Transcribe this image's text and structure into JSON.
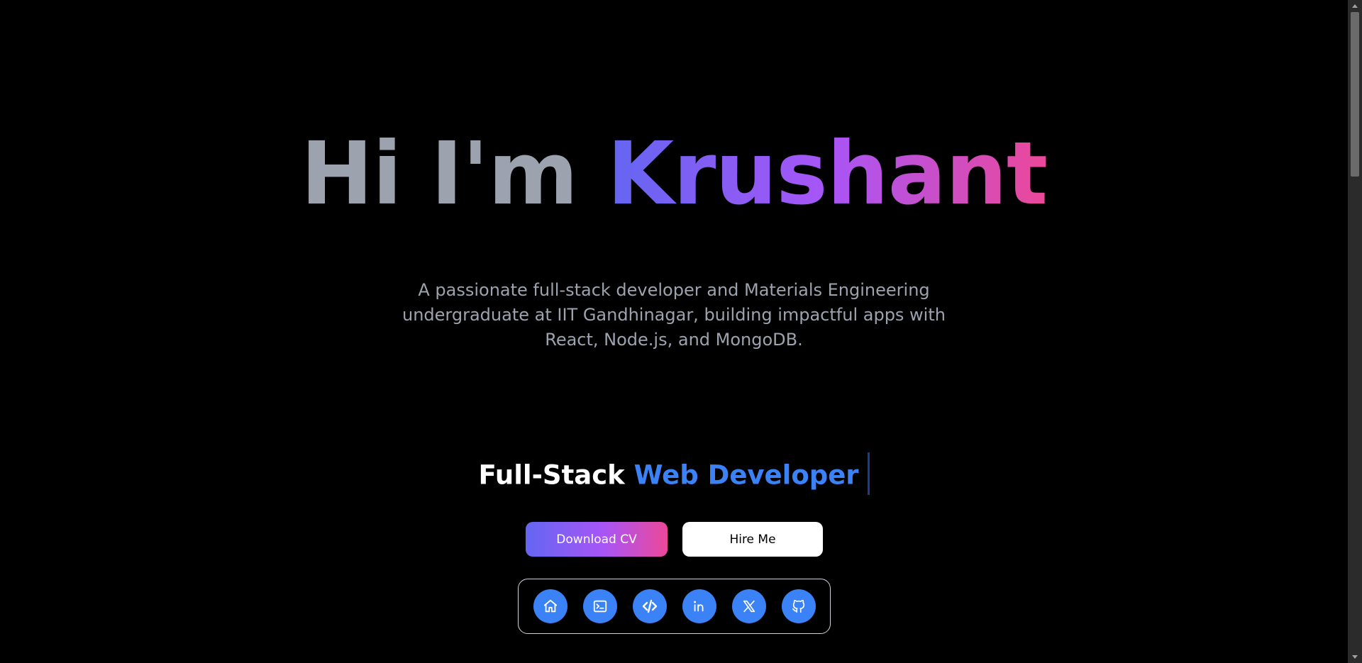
{
  "hero": {
    "greeting": "Hi I'm ",
    "name": "Krushant",
    "intro": "A passionate full-stack developer and Materials Engineering undergraduate at IIT Gandhinagar, building impactful apps with React, Node.js, and MongoDB.",
    "role_part1": "Full-Stack ",
    "role_part2": "Web Developer"
  },
  "buttons": {
    "download_cv": "Download CV",
    "hire_me": "Hire Me"
  },
  "social": {
    "icons": [
      "home-icon",
      "terminal-icon",
      "code-icon",
      "linkedin-icon",
      "x-icon",
      "github-icon"
    ]
  },
  "colors": {
    "background": "#000000",
    "greeting": "#9ca3af",
    "gradient_start": "#6366f1",
    "gradient_mid": "#a855f7",
    "gradient_end": "#ec4899",
    "accent_blue": "#3b82f6",
    "intro_text": "#9ca3af"
  }
}
